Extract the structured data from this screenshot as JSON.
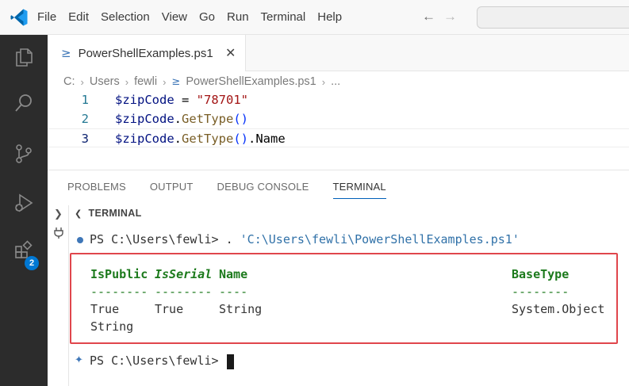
{
  "menu": {
    "items": [
      "File",
      "Edit",
      "Selection",
      "View",
      "Go",
      "Run",
      "Terminal",
      "Help"
    ],
    "back_icon": "arrow-left-icon",
    "forward_icon": "arrow-right-icon"
  },
  "activity_bar": {
    "items": [
      "explorer-icon",
      "search-icon",
      "source-control-icon",
      "run-debug-icon",
      "extensions-icon"
    ],
    "extensions_badge": "2"
  },
  "editor": {
    "tab": {
      "label": "PowerShellExamples.ps1",
      "icon": "powershell-file-icon",
      "close_icon": "close-icon"
    },
    "breadcrumb": [
      "C:",
      "Users",
      "fewli",
      "PowerShellExamples.ps1",
      "..."
    ],
    "lines": [
      {
        "number": "1",
        "text": "$zipCode = \"78701\""
      },
      {
        "number": "2",
        "text": "$zipCode.GetType()"
      },
      {
        "number": "3",
        "text": "$zipCode.GetType().Name"
      }
    ],
    "code": {
      "l1": {
        "var": "$zipCode",
        "op": " = ",
        "str": "\"78701\""
      },
      "l2": {
        "var": "$zipCode",
        "dot": ".",
        "fn": "GetType",
        "parens": "()"
      },
      "l3": {
        "var": "$zipCode",
        "dot": ".",
        "fn": "GetType",
        "parens": "()",
        "rest": ".Name"
      }
    }
  },
  "panel": {
    "tabs": [
      "PROBLEMS",
      "OUTPUT",
      "DEBUG CONSOLE",
      "TERMINAL"
    ],
    "active_tab": "TERMINAL",
    "section_title": "TERMINAL"
  },
  "terminal": {
    "prompt": "PS C:\\Users\\fewli>",
    "command_prefix": " . ",
    "command_path": "'C:\\Users\\fewli\\PowerShellExamples.ps1'",
    "headers": {
      "is_public": "IsPublic",
      "is_serial": "IsSerial",
      "name": "Name",
      "base_type": "BaseType"
    },
    "separators": {
      "is_public": "--------",
      "is_serial": "--------",
      "name": "----",
      "base_type": "--------"
    },
    "row": {
      "is_public": "True",
      "is_serial": "True",
      "name": "String",
      "base_type": "System.Object"
    },
    "name_output": "String",
    "final_prompt": "PS C:\\Users\\fewli>"
  },
  "colors": {
    "accent": "#0078d4",
    "highlight_box": "#e0464c",
    "header_green": "#1c7a1c",
    "string_red": "#a31515",
    "function_brown": "#795e26"
  }
}
